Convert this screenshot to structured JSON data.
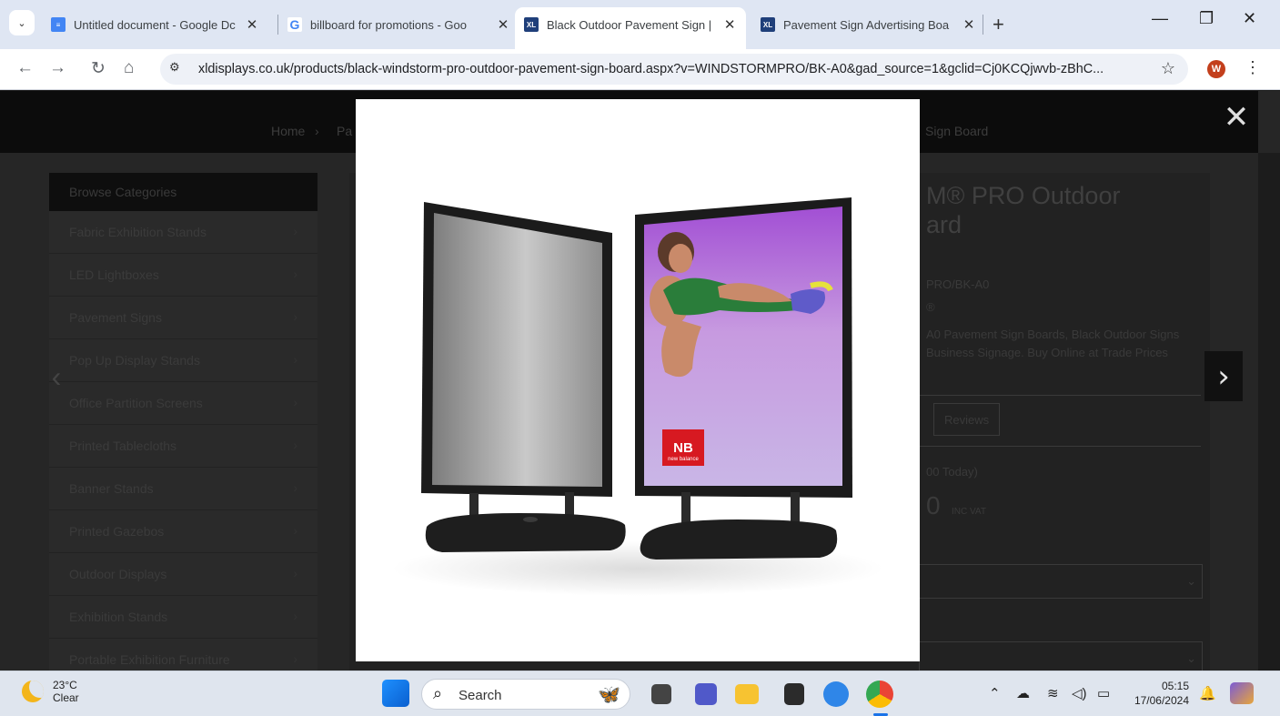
{
  "browser": {
    "tabs": [
      {
        "title": "Untitled document - Google Dc",
        "active": false,
        "favicon": "google-docs-icon"
      },
      {
        "title": "billboard for promotions - Goo",
        "active": false,
        "favicon": "google-icon"
      },
      {
        "title": "Black Outdoor Pavement Sign |",
        "active": true,
        "favicon": "xl-icon"
      },
      {
        "title": "Pavement Sign Advertising Boa",
        "active": false,
        "favicon": "xl-icon"
      }
    ],
    "url": "xldisplays.co.uk/products/black-windstorm-pro-outdoor-pavement-sign-board.aspx?v=WINDSTORMPRO/BK-A0&gad_source=1&gclid=Cj0KCQjwvb-zBhC..."
  },
  "page": {
    "breadcrumb": {
      "home": "Home",
      "sep": "›",
      "partial": "Pa",
      "tail": "Sign Board"
    },
    "sidebar": {
      "header": "Browse Categories",
      "items": [
        "Fabric Exhibition Stands",
        "LED Lightboxes",
        "Pavement Signs",
        "Pop Up Display Stands",
        "Office Partition Screens",
        "Printed Tablecloths",
        "Banner Stands",
        "Printed Gazebos",
        "Outdoor Displays",
        "Exhibition Stands",
        "Portable Exhibition Furniture"
      ]
    },
    "product": {
      "title_line1": "M® PRO Outdoor",
      "title_line2": "ard",
      "code": "PRO/BK-A0",
      "brand_mark": "®",
      "desc_line1": "A0 Pavement Sign Boards, Black Outdoor Signs",
      "desc_line2": "Business Signage. Buy Online at Trade Prices",
      "reviews_tab": "Reviews",
      "dispatch": "00 Today)",
      "price_digit": "0",
      "price_suffix": "INC VAT"
    }
  },
  "lightbox": {
    "brand_badge": "new balance"
  },
  "taskbar": {
    "temperature": "23°C",
    "condition": "Clear",
    "search_label": "Search",
    "time": "05:15",
    "date": "17/06/2024"
  },
  "colors": {
    "tabstrip": "#dfe6f3",
    "overlay_bg": "#262626",
    "poster_purple": "#b98ad6",
    "nb_red": "#d71921"
  }
}
